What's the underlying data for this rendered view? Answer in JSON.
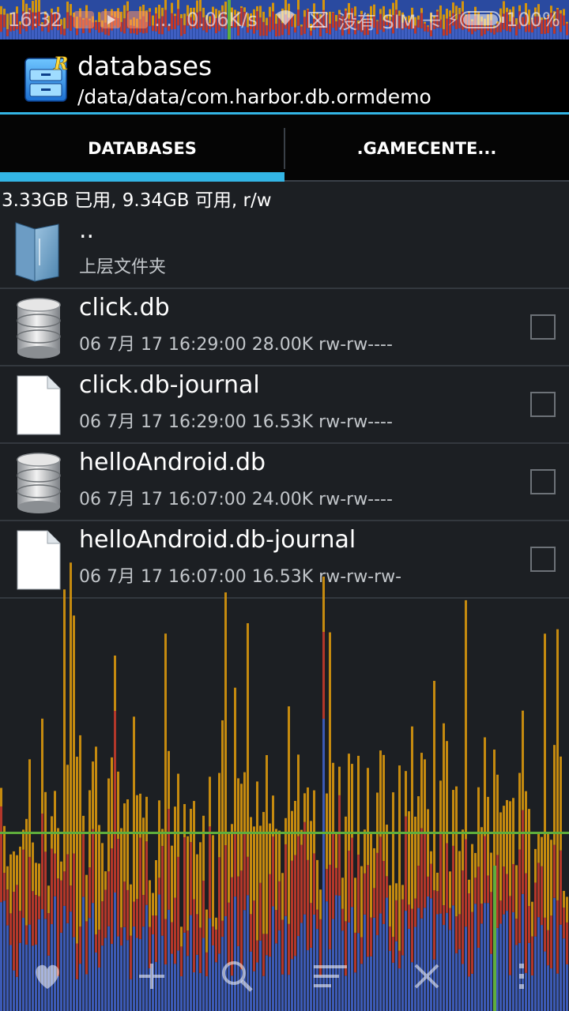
{
  "status_bar": {
    "time": "16:32",
    "dots": "...",
    "speed": "0.06K/s",
    "sim_text": "没有 SIM 卡",
    "battery": "100%",
    "battery_level": 1.0
  },
  "header": {
    "title": "databases",
    "path": "/data/data/com.harbor.db.ormdemo",
    "logo_letter": "R"
  },
  "tabs": [
    {
      "label": "DATABASES",
      "active": true
    },
    {
      "label": ".GAMECENTE...",
      "active": false
    }
  ],
  "storage": "3.33GB 已用, 9.34GB 可用, r/w",
  "parent_folder": {
    "name": "..",
    "subtitle": "上层文件夹"
  },
  "files": [
    {
      "name": "click.db",
      "meta": "06 7月 17 16:29:00  28.00K  rw-rw----",
      "icon": "database-icon"
    },
    {
      "name": "click.db-journal",
      "meta": "06 7月 17 16:29:00  16.53K  rw-rw----",
      "icon": "file-icon"
    },
    {
      "name": "helloAndroid.db",
      "meta": "06 7月 17 16:07:00  24.00K  rw-rw----",
      "icon": "database-icon"
    },
    {
      "name": "helloAndroid.db-journal",
      "meta": "06 7月 17 16:07:00  16.53K  rw-rw-rw-",
      "icon": "file-icon"
    }
  ],
  "colors": {
    "accent": "#33b5e5",
    "graph_blue": "#3f5fc2",
    "graph_red": "#c0392b",
    "graph_orange": "#d4940e",
    "graph_green": "#5fae3c"
  }
}
